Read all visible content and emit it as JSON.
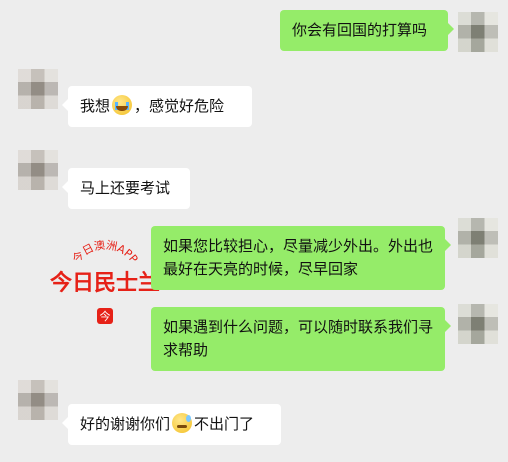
{
  "messages": [
    {
      "side": "right",
      "text": "你会有回国的打算吗"
    },
    {
      "side": "left",
      "parts": [
        "我想",
        "，感觉好危险"
      ],
      "emoji": "crying-face-icon"
    },
    {
      "side": "left",
      "text": "马上还要考试"
    },
    {
      "side": "right",
      "text": "如果您比较担心，尽量减少外出。外出也最好在天亮的时候，尽早回家"
    },
    {
      "side": "right",
      "text": "如果遇到什么问题，可以随时联系我们寻求帮助"
    },
    {
      "side": "left",
      "parts": [
        "好的谢谢你们",
        "不出门了"
      ],
      "emoji": "sweat-face-icon"
    }
  ],
  "watermark": {
    "arc_text": "今日澳洲APP",
    "brand": "今日民士兰",
    "badge": "今"
  },
  "colors": {
    "background": "#ededed",
    "incoming_bubble": "#ffffff",
    "outgoing_bubble": "#95ec69",
    "watermark_red": "#e62117"
  }
}
